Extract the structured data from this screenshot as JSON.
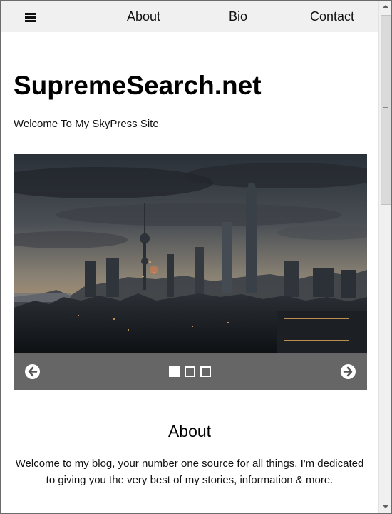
{
  "nav": {
    "menu_icon": "hamburger-menu-icon",
    "links": [
      "About",
      "Bio",
      "Contact"
    ]
  },
  "header": {
    "title": "SupremeSearch.net",
    "tagline": "Welcome To My SkyPress Site"
  },
  "slideshow": {
    "image": "city-skyline-at-dusk",
    "prev_icon": "arrow-left-circle-icon",
    "next_icon": "arrow-right-circle-icon",
    "slide_count": 3,
    "active_slide": 1
  },
  "about": {
    "heading": "About",
    "text": "Welcome to my blog, your number one source for all things. I'm dedicated to giving you the very best of my stories, information & more."
  },
  "colors": {
    "navbar_bg": "#f0f0f0",
    "slider_controls_bg": "#666666",
    "text": "#111111"
  }
}
